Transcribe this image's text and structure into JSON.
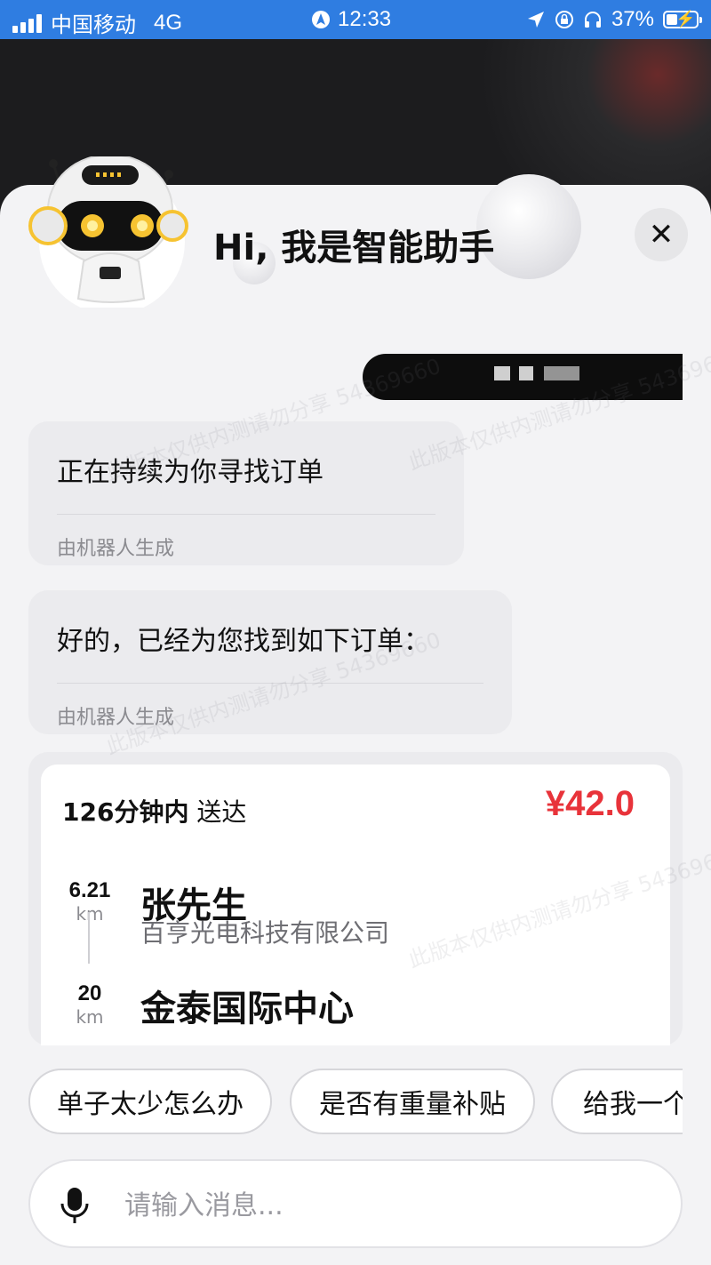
{
  "status_bar": {
    "carrier": "中国移动",
    "network": "4G",
    "time": "12:33",
    "battery_percent": "37%",
    "battery_level": 0.37
  },
  "header": {
    "title": "Hi, 我是智能助手",
    "close_label": "✕"
  },
  "messages": [
    {
      "text": "正在持续为你寻找订单",
      "footer": "由机器人生成"
    },
    {
      "text": "好的，已经为您找到如下订单：",
      "footer": "由机器人生成"
    }
  ],
  "order": {
    "eta_value": "126分钟内",
    "eta_suffix": "送达",
    "price": "¥42.0",
    "pickup_distance": "6.21",
    "pickup_unit": "km",
    "pickup_name": "张先生",
    "pickup_company": "百亨光电科技有限公司",
    "dropoff_distance": "20",
    "dropoff_unit": "km",
    "dropoff_name": "金泰国际中心"
  },
  "quick_replies": [
    "单子太少怎么办",
    "是否有重量补贴",
    "给我一个"
  ],
  "input": {
    "placeholder": "请输入消息..."
  },
  "colors": {
    "status_bar": "#2f7de1",
    "price": "#e8333a",
    "sheet_bg": "#f3f3f5"
  }
}
